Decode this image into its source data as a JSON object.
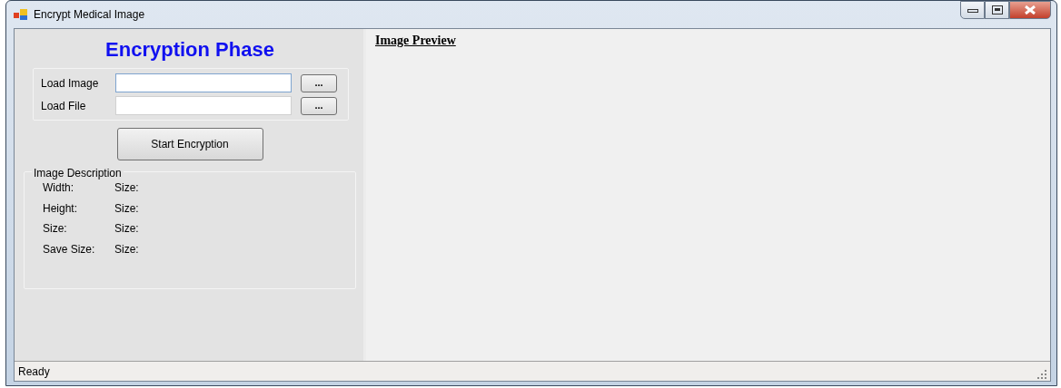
{
  "window": {
    "title": "Encrypt Medical Image"
  },
  "left_panel": {
    "heading": "Encryption Phase",
    "inputs": [
      {
        "label": "Load Image",
        "browse": "...",
        "focused": true
      },
      {
        "label": "Load File",
        "browse": "...",
        "focused": false
      }
    ],
    "start_button": "Start Encryption",
    "description": {
      "title": "Image Description",
      "rows": [
        {
          "label": "Width:",
          "value": "Size:"
        },
        {
          "label": "Height:",
          "value": "Size:"
        },
        {
          "label": "Size:",
          "value": "Size:"
        },
        {
          "label": "Save Size:",
          "value": "Size:"
        }
      ]
    }
  },
  "preview": {
    "title": "Image Preview"
  },
  "status_bar": {
    "text": "Ready"
  }
}
